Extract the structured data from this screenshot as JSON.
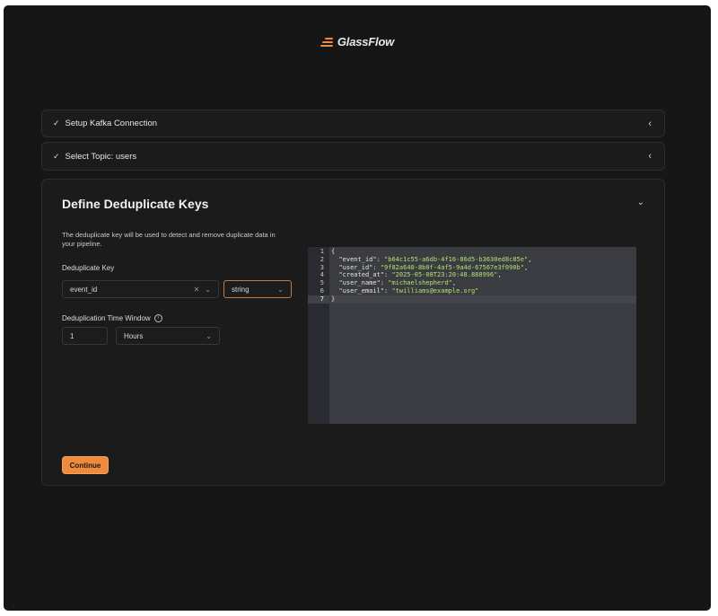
{
  "brand": {
    "name": "GlassFlow"
  },
  "steps": [
    {
      "label": "Setup Kafka Connection",
      "status": "done"
    },
    {
      "label": "Select Topic: users",
      "status": "done"
    }
  ],
  "dedup": {
    "title": "Define Deduplicate Keys",
    "description": "The deduplicate key will be used to detect and remove duplicate data in your pipeline.",
    "key_label": "Deduplicate Key",
    "key_value": "event_id",
    "type_value": "string",
    "window_label": "Deduplication Time Window",
    "window_value": "1",
    "window_unit": "Hours",
    "continue_label": "Continue"
  },
  "editor": {
    "line_numbers": [
      "1",
      "2",
      "3",
      "4",
      "5",
      "6",
      "7"
    ],
    "lines": [
      {
        "open": "{"
      },
      {
        "key": "\"event_id\"",
        "value": "\"b64c1c55-a6db-4f16-86d5-b3630ed8c85e\"",
        "trail": ","
      },
      {
        "key": "\"user_id\"",
        "value": "\"9f82a640-8b0f-4af5-9a4d-67567e3f090b\"",
        "trail": ","
      },
      {
        "key": "\"created_at\"",
        "value": "\"2025-05-08T23:20:48.888996\"",
        "trail": ","
      },
      {
        "key": "\"user_name\"",
        "value": "\"michaelshepherd\"",
        "trail": ","
      },
      {
        "key": "\"user_email\"",
        "value": "\"twilliams@example.org\"",
        "trail": ""
      },
      {
        "open": "}"
      }
    ]
  },
  "colors": {
    "accent": "#f08a3c",
    "background": "#161616",
    "code_string": "#b5e26b"
  }
}
